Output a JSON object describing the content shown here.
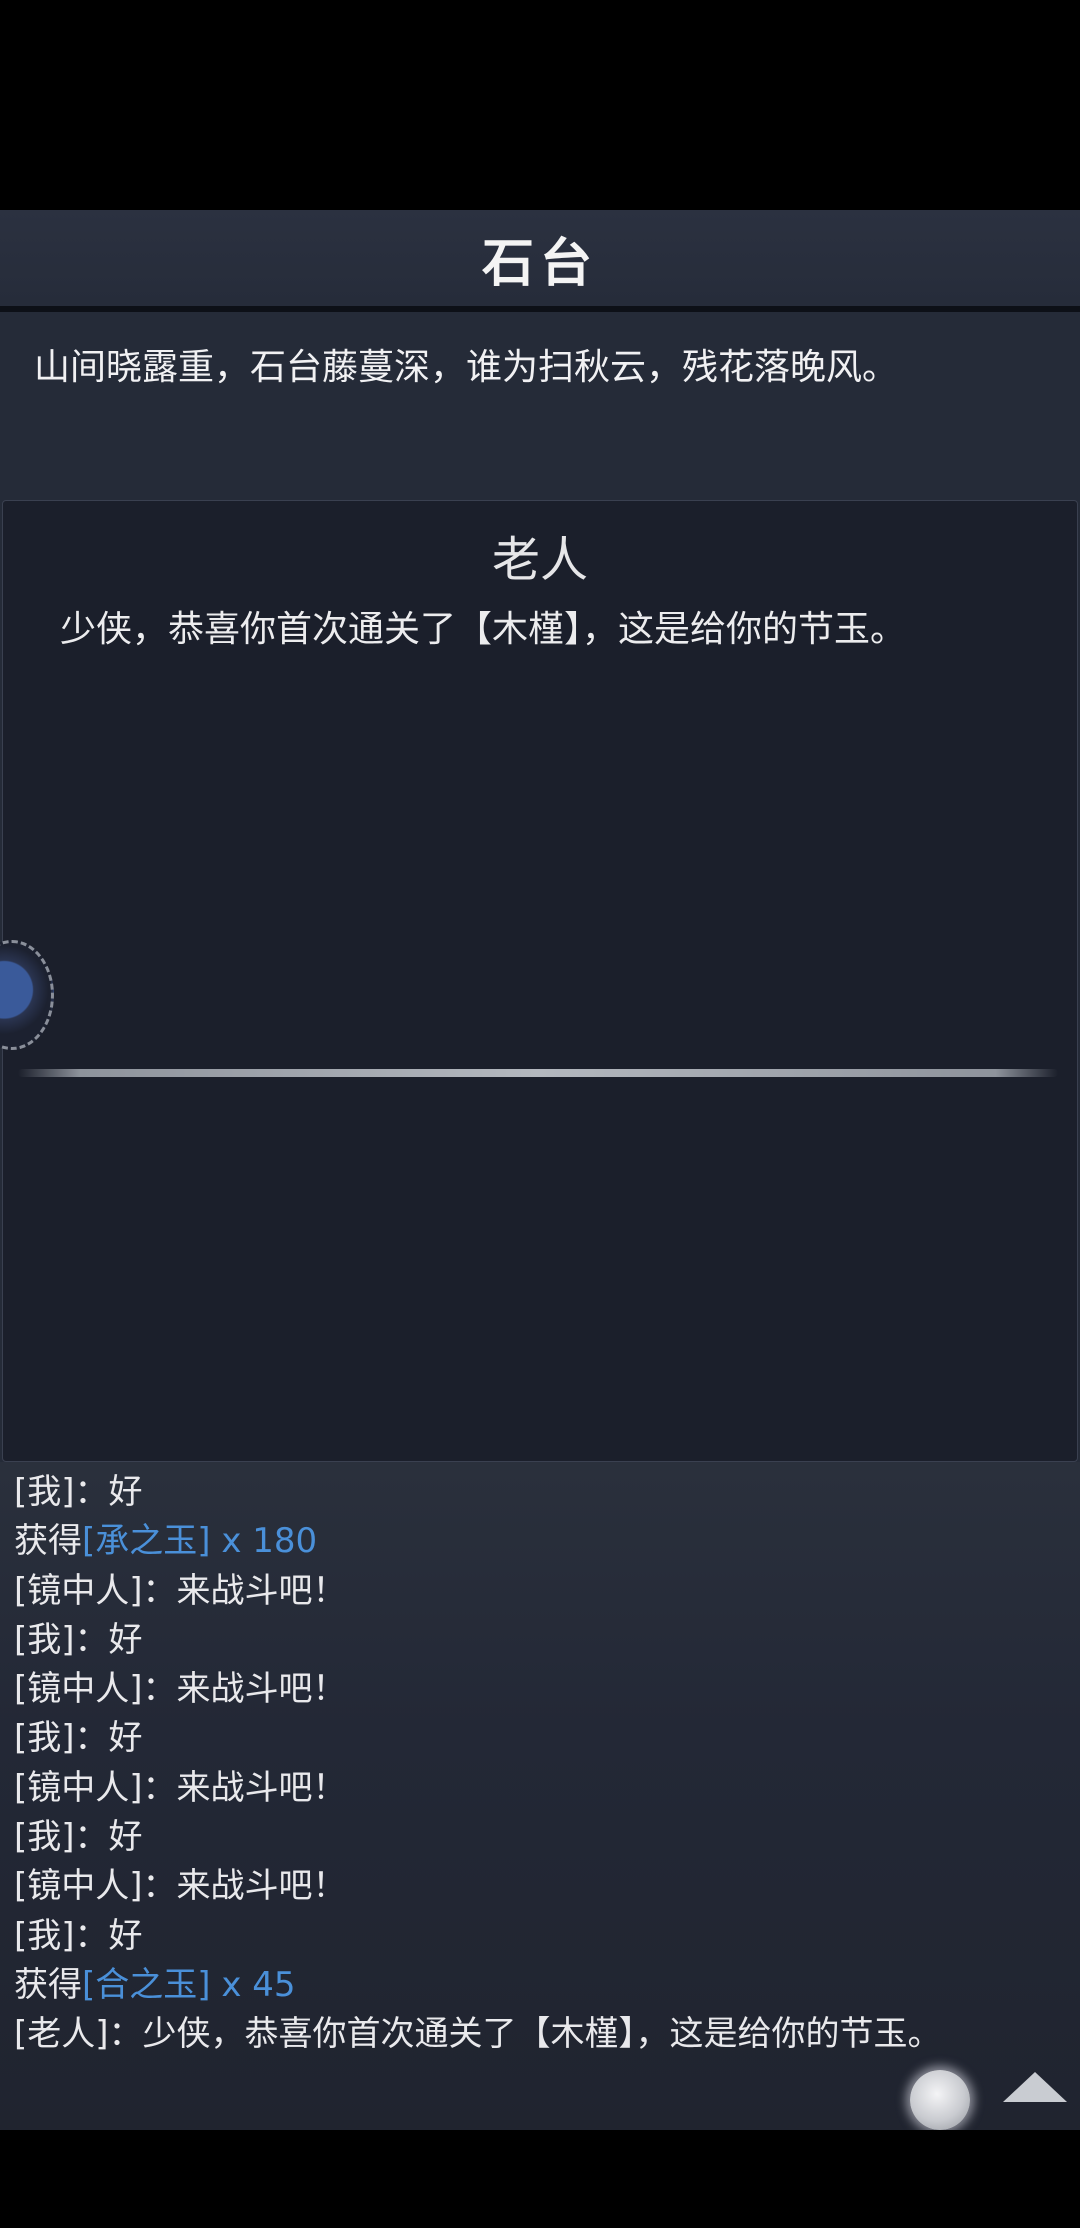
{
  "header": {
    "title": "石台"
  },
  "location": {
    "description": "山间晓露重，石台藤蔓深，谁为扫秋云，残花落晚风。"
  },
  "dialog": {
    "speaker": "老人",
    "text": "少侠，恭喜你首次通关了【木槿】，这是给你的节玉。"
  },
  "log": {
    "lines": [
      {
        "prefix": "[我]：好",
        "item": "",
        "suffix": ""
      },
      {
        "prefix": "获得",
        "item": "[承之玉]",
        "suffix": " x 180"
      },
      {
        "prefix": "[镜中人]：来战斗吧！",
        "item": "",
        "suffix": ""
      },
      {
        "prefix": "[我]：好",
        "item": "",
        "suffix": ""
      },
      {
        "prefix": "[镜中人]：来战斗吧！",
        "item": "",
        "suffix": ""
      },
      {
        "prefix": "[我]：好",
        "item": "",
        "suffix": ""
      },
      {
        "prefix": "[镜中人]：来战斗吧！",
        "item": "",
        "suffix": ""
      },
      {
        "prefix": "[我]：好",
        "item": "",
        "suffix": ""
      },
      {
        "prefix": "[镜中人]：来战斗吧！",
        "item": "",
        "suffix": ""
      },
      {
        "prefix": "[我]：好",
        "item": "",
        "suffix": ""
      },
      {
        "prefix": "获得",
        "item": "[合之玉]",
        "suffix": " x 45"
      },
      {
        "prefix": "[老人]：少侠，恭喜你首次通关了【木槿】，这是给你的节玉。",
        "item": "",
        "suffix": ""
      }
    ]
  },
  "controls": {
    "orb_icon": "orb-icon",
    "scroll_up_icon": "triangle-up-icon"
  },
  "colors": {
    "item_link": "#4a90d9",
    "panel_bg": "#1b1f2b",
    "game_bg": "#252b38"
  }
}
